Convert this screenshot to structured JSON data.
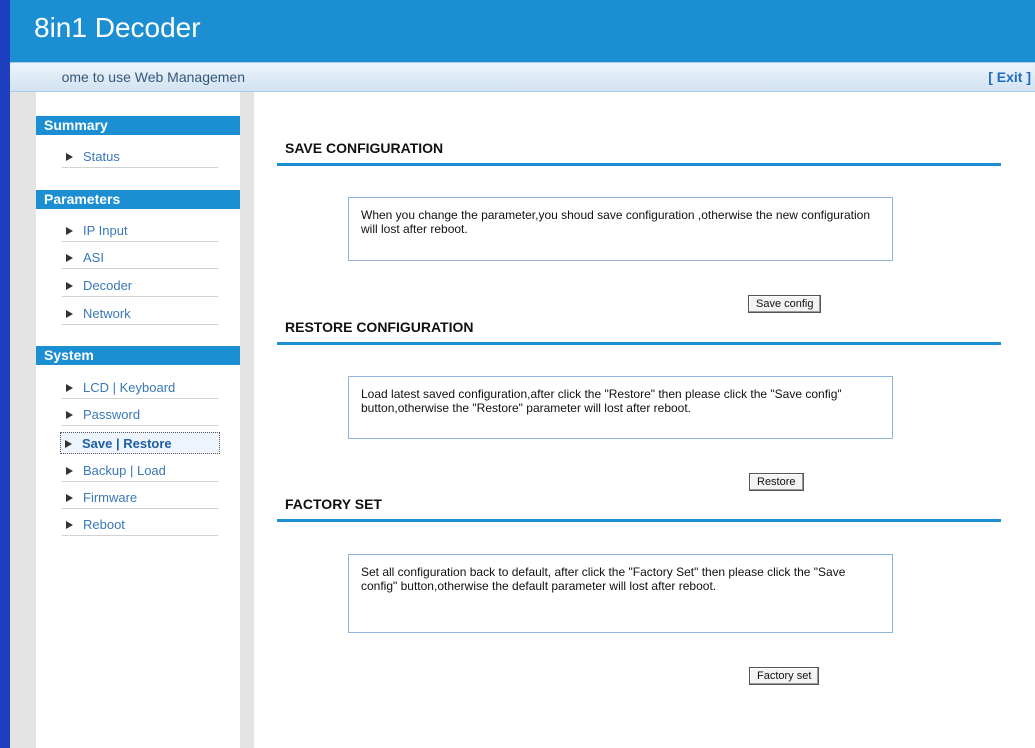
{
  "header": {
    "title": "8in1 Decoder"
  },
  "welcome_bar": {
    "text": "ome to use Web Managemen",
    "exit_label": "[ Exit ]"
  },
  "sidebar": {
    "sections": [
      {
        "title": "Summary",
        "items": [
          "Status"
        ]
      },
      {
        "title": "Parameters",
        "items": [
          "IP Input",
          "ASI",
          "Decoder",
          "Network"
        ]
      },
      {
        "title": "System",
        "items": [
          "LCD | Keyboard",
          "Password",
          "Save | Restore",
          "Backup | Load",
          "Firmware",
          "Reboot"
        ]
      }
    ],
    "active_item": "Save | Restore"
  },
  "main": {
    "save": {
      "title": "SAVE CONFIGURATION",
      "description": "When you change the parameter,you shoud save configuration ,otherwise the new configuration will lost after reboot.",
      "button_label": "Save config"
    },
    "restore": {
      "title": "RESTORE CONFIGURATION",
      "description": "Load latest saved configuration,after click the \"Restore\" then please click the \"Save config\" button,otherwise the \"Restore\" parameter will lost after reboot.",
      "button_label": "Restore"
    },
    "factory": {
      "title": "FACTORY SET",
      "description": "Set all configuration back to default, after click the \"Factory Set\" then please click the \"Save config\" button,otherwise the default parameter will lost after reboot.",
      "button_label": "Factory set"
    }
  },
  "colors": {
    "accent": "#1c8fd3",
    "left_edge": "#1d3fbf",
    "link": "#3a78b8"
  }
}
